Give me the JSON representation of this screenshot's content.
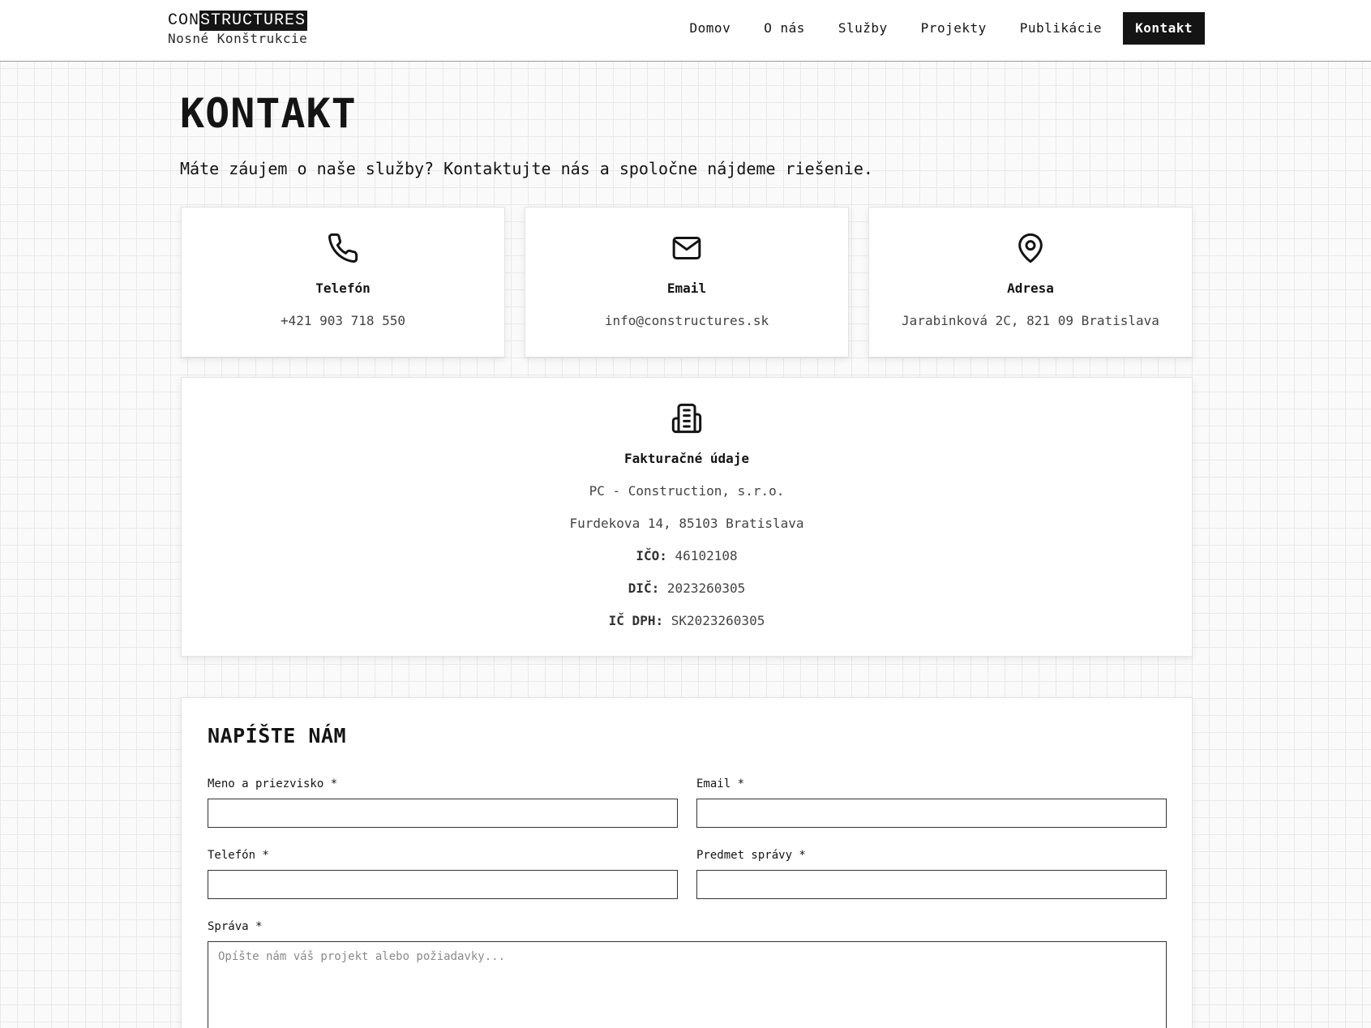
{
  "header": {
    "logo_prefix": "CON",
    "logo_inverted": "STRUCTURES",
    "logo_subtitle": "Nosné Konštrukcie",
    "nav": [
      "Domov",
      "O nás",
      "Služby",
      "Projekty",
      "Publikácie",
      "Kontakt"
    ],
    "active_nav": "Kontakt"
  },
  "page": {
    "title": "KONTAKT",
    "lead": "Máte záujem o naše služby? Kontaktujte nás a spoločne nájdeme riešenie."
  },
  "contact_cards": [
    {
      "icon": "phone-icon",
      "title": "Telefón",
      "value": "+421 903 718 550"
    },
    {
      "icon": "mail-icon",
      "title": "Email",
      "value": "info@constructures.sk"
    },
    {
      "icon": "map-pin-icon",
      "title": "Adresa",
      "value": "Jarabinková 2C, 821 09 Bratislava"
    }
  ],
  "billing": {
    "icon": "building-icon",
    "title": "Fakturačné údaje",
    "company": "PC - Construction, s.r.o.",
    "address": "Furdekova 14, 85103 Bratislava",
    "ico_label": "IČO:",
    "ico_value": "46102108",
    "dic_label": "DIČ:",
    "dic_value": "2023260305",
    "icdph_label": "IČ DPH:",
    "icdph_value": "SK2023260305"
  },
  "form": {
    "title": "NAPÍŠTE NÁM",
    "name_label": "Meno a priezvisko *",
    "email_label": "Email *",
    "phone_label": "Telefón *",
    "subject_label": "Predmet správy *",
    "message_label": "Správa *",
    "message_placeholder": "Opíšte nám váš projekt alebo požiadavky...",
    "name_value": "",
    "email_value": "",
    "phone_value": "",
    "subject_value": ""
  },
  "colors": {
    "ink": "#141414",
    "muted": "#444444",
    "grid": "#e9e9e9",
    "card": "#ffffff"
  }
}
